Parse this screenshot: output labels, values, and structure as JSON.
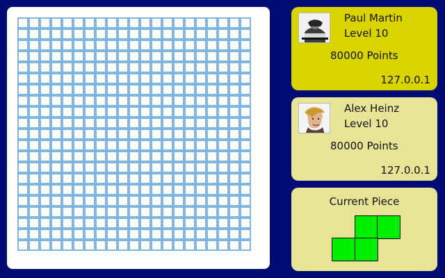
{
  "board": {
    "rows": 21,
    "cols": 21
  },
  "players": [
    {
      "name": "Paul Martin",
      "level": "Level 10",
      "points": "80000 Points",
      "ip": "127.0.0.1",
      "status_color": "#d9d400"
    },
    {
      "name": "Alex Heinz",
      "level": "Level 10",
      "points": "80000 Points",
      "ip": "127.0.0.1",
      "status_color": "#e8e496"
    }
  ],
  "current_piece": {
    "title": "Current Piece",
    "shape": "S-tetromino",
    "color": "#00ef00"
  },
  "colors": {
    "background": "#000c74",
    "grid_line": "#7fb6e2"
  }
}
